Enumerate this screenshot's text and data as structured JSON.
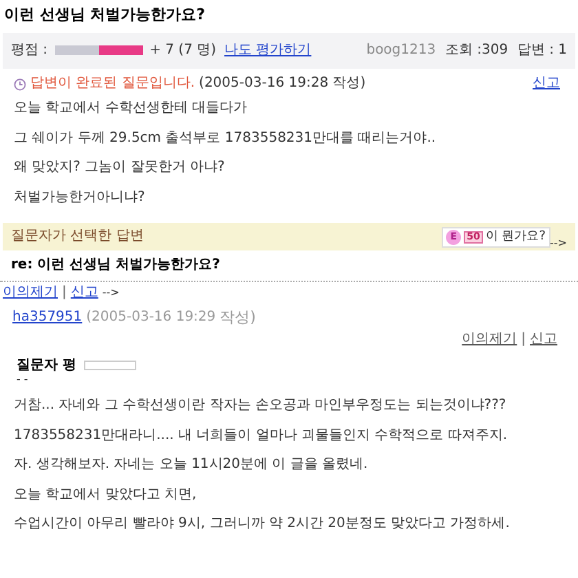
{
  "title": "이런 선생님 처벌가능한가요?",
  "rating": {
    "label": "평점 :",
    "level": 0.5,
    "score": "+ 7 (7 명)",
    "link": "나도 평가하기",
    "user": "boog1213",
    "views_label": "조회",
    "views": ":309",
    "answers_label": "답변",
    "answers": ": 1"
  },
  "status": {
    "message": "답변이 완료된 질문입니다.",
    "date": "(2005-03-16 19:28 작성)",
    "report": "신고"
  },
  "question": [
    "오늘 학교에서 수학선생한테 대들다가",
    "그 쉐이가 두께 29.5cm 출석부로 1783558231만대를 때리는거야..",
    "왜 맞았지? 그놈이 잘못한거 아냐?",
    "처벌가능한거아니냐?"
  ],
  "selected_band": {
    "label": "질문자가 선택한 답변",
    "badge_e": "E",
    "badge_num": "50",
    "badge_text": "이 뭔가요?",
    "tail": "-->"
  },
  "answer": {
    "title": "re: 이런 선생님 처벌가능한가요?",
    "top_links": [
      "이의제기",
      "신고"
    ],
    "separator": "|",
    "top_tail": "-->",
    "author": "ha357951",
    "date": "(2005-03-16 19:29",
    "date_suffix": "작성)",
    "links": [
      "이의제기",
      "신고"
    ],
    "review_label": "질문자 평",
    "review_text": "- -",
    "body": [
      "거참... 자네와 그 수학선생이란 작자는 손오공과 마인부우정도는 되는것이냐???",
      "1783558231만대라니.... 내 너희들이 얼마나 괴물들인지 수학적으로 따져주지.",
      "자. 생각해보자. 자네는 오늘 11시20분에 이 글을 올렸네.",
      "오늘 학교에서 맞았다고 치면,",
      "수업시간이 아무리 빨라야 9시, 그러니까 약 2시간 20분정도 맞았다고 가정하세."
    ]
  }
}
